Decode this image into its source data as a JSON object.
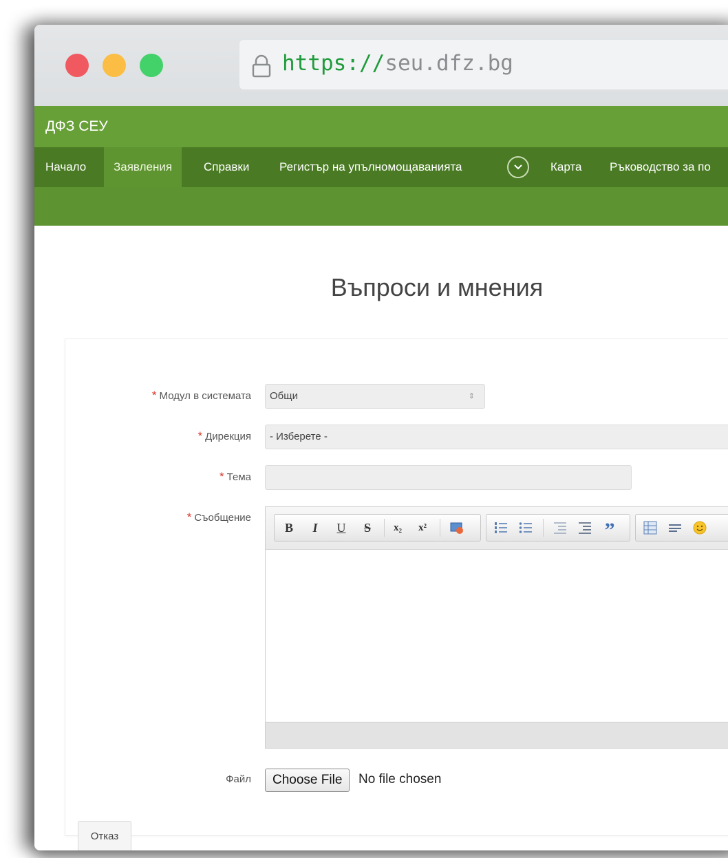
{
  "browser": {
    "url_protocol": "https://",
    "url_host": "seu.dfz.bg"
  },
  "site": {
    "brand": "ДФЗ СЕУ",
    "nav": [
      {
        "label": "Начало"
      },
      {
        "label": "Заявления"
      },
      {
        "label": "Справки"
      },
      {
        "label": "Регистър на упълномощаванията"
      },
      {
        "label": "Карта"
      },
      {
        "label": "Ръководство за по"
      }
    ],
    "active_nav": "Заявления"
  },
  "form": {
    "title": "Въпроси и мнения",
    "required_mark": "*",
    "module_label": "Модул в системата",
    "module_value": "Общи",
    "direction_label": "Дирекция",
    "direction_value": "- Изберете -",
    "topic_label": "Тема",
    "topic_value": "",
    "message_label": "Съобщение",
    "file_label": "Файл",
    "file_button": "Choose File",
    "file_status": "No file chosen",
    "cancel_label": "Отказ"
  },
  "editor_toolbar": {
    "bold": "B",
    "italic": "I",
    "underline": "U",
    "strike": "S",
    "subscript": "x₂",
    "superscript": "x²",
    "quote": "”"
  },
  "colors": {
    "brand_green": "#68a038",
    "nav_green": "#4a7b24",
    "active_nav": "#5e9530",
    "required_red": "#d9362a"
  }
}
